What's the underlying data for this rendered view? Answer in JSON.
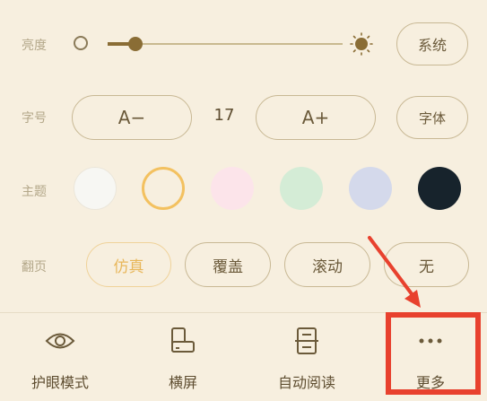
{
  "brightness": {
    "label": "亮度",
    "level": 0.12,
    "system_button": "系统",
    "icons": [
      "brightness-low-icon",
      "brightness-high-icon"
    ]
  },
  "font_size": {
    "label": "字号",
    "decrease_label": "A−",
    "value": "17",
    "increase_label": "A+",
    "font_button": "字体"
  },
  "theme": {
    "label": "主题",
    "swatches": [
      "#f7f7f3",
      "#f7efdf",
      "#fce4ea",
      "#d4ecd6",
      "#d4d9eb",
      "#17232c"
    ],
    "selected_index": 1,
    "selected_ring_color": "#f3c160"
  },
  "page_turn": {
    "label": "翻页",
    "options": [
      "仿真",
      "覆盖",
      "滚动",
      "无"
    ],
    "selected_index": 0,
    "selected_color": "#e8b75b"
  },
  "bottom_nav": {
    "items": [
      {
        "label": "护眼模式",
        "icon": "eye-icon"
      },
      {
        "label": "横屏",
        "icon": "landscape-phone-icon"
      },
      {
        "label": "自动阅读",
        "icon": "auto-read-icon"
      },
      {
        "label": "更多",
        "icon": "more-dots-icon"
      }
    ]
  },
  "annotation": {
    "color": "#e8412e",
    "target": "更多"
  }
}
